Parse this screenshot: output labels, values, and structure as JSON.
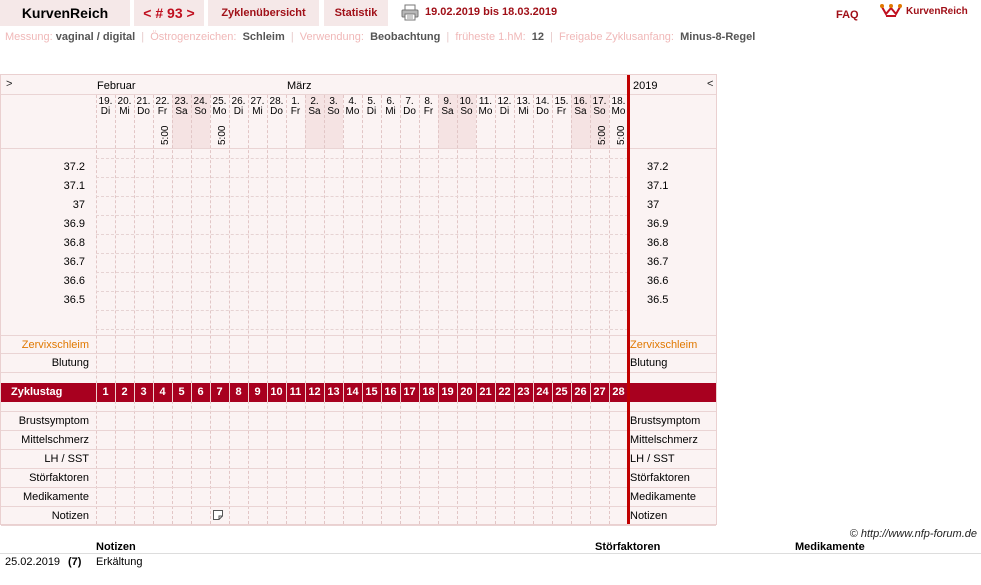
{
  "header": {
    "brand": "KurvenReich",
    "cycle_nav": "< # 93 >",
    "tab_overview": "Zyklenübersicht",
    "tab_statistics": "Statistik",
    "date_range": "19.02.2019 bis 18.03.2019",
    "faq": "FAQ",
    "logo_text": "KurvenReich",
    "accent_color": "#a01018"
  },
  "settings": {
    "measurement_label": "Messung:",
    "measurement_value": "vaginal / digital",
    "estrogen_label": "Östrogenzeichen:",
    "estrogen_value": "Schleim",
    "usage_label": "Verwendung:",
    "usage_value": "Beobachtung",
    "earliest_label": "früheste 1.hM:",
    "earliest_value": "12",
    "release_label": "Freigabe Zyklusanfang:",
    "release_value": "Minus-8-Regel"
  },
  "grid": {
    "nav_left": ">",
    "nav_right": "<",
    "month_feb": "Februar",
    "month_mar": "März",
    "year": "2019",
    "days": [
      {
        "d": "19.",
        "w": "Di",
        "weekend": false,
        "time": ""
      },
      {
        "d": "20.",
        "w": "Mi",
        "weekend": false,
        "time": ""
      },
      {
        "d": "21.",
        "w": "Do",
        "weekend": false,
        "time": ""
      },
      {
        "d": "22.",
        "w": "Fr",
        "weekend": false,
        "time": "5:00"
      },
      {
        "d": "23.",
        "w": "Sa",
        "weekend": true,
        "time": ""
      },
      {
        "d": "24.",
        "w": "So",
        "weekend": true,
        "time": ""
      },
      {
        "d": "25.",
        "w": "Mo",
        "weekend": false,
        "time": "5:00"
      },
      {
        "d": "26.",
        "w": "Di",
        "weekend": false,
        "time": ""
      },
      {
        "d": "27.",
        "w": "Mi",
        "weekend": false,
        "time": ""
      },
      {
        "d": "28.",
        "w": "Do",
        "weekend": false,
        "time": ""
      },
      {
        "d": "1.",
        "w": "Fr",
        "weekend": false,
        "time": ""
      },
      {
        "d": "2.",
        "w": "Sa",
        "weekend": true,
        "time": ""
      },
      {
        "d": "3.",
        "w": "So",
        "weekend": true,
        "time": ""
      },
      {
        "d": "4.",
        "w": "Mo",
        "weekend": false,
        "time": ""
      },
      {
        "d": "5.",
        "w": "Di",
        "weekend": false,
        "time": ""
      },
      {
        "d": "6.",
        "w": "Mi",
        "weekend": false,
        "time": ""
      },
      {
        "d": "7.",
        "w": "Do",
        "weekend": false,
        "time": ""
      },
      {
        "d": "8.",
        "w": "Fr",
        "weekend": false,
        "time": ""
      },
      {
        "d": "9.",
        "w": "Sa",
        "weekend": true,
        "time": ""
      },
      {
        "d": "10.",
        "w": "So",
        "weekend": true,
        "time": ""
      },
      {
        "d": "11.",
        "w": "Mo",
        "weekend": false,
        "time": ""
      },
      {
        "d": "12.",
        "w": "Di",
        "weekend": false,
        "time": ""
      },
      {
        "d": "13.",
        "w": "Mi",
        "weekend": false,
        "time": ""
      },
      {
        "d": "14.",
        "w": "Do",
        "weekend": false,
        "time": ""
      },
      {
        "d": "15.",
        "w": "Fr",
        "weekend": false,
        "time": ""
      },
      {
        "d": "16.",
        "w": "Sa",
        "weekend": true,
        "time": ""
      },
      {
        "d": "17.",
        "w": "So",
        "weekend": true,
        "time": "5:00"
      },
      {
        "d": "18.",
        "w": "Mo",
        "weekend": false,
        "time": "5:00"
      }
    ],
    "temperatures": [
      "37.2",
      "37.1",
      "37",
      "36.9",
      "36.8",
      "36.7",
      "36.6",
      "36.5"
    ],
    "row_zervix": "Zervixschleim",
    "row_blutung": "Blutung",
    "zyklustag_label": "Zyklustag",
    "cycle_days": [
      1,
      2,
      3,
      4,
      5,
      6,
      7,
      8,
      9,
      10,
      11,
      12,
      13,
      14,
      15,
      16,
      17,
      18,
      19,
      20,
      21,
      22,
      23,
      24,
      25,
      26,
      27,
      28
    ],
    "rows_bottom": [
      "Brustsymptom",
      "Mittelschmerz",
      "LH / SST",
      "Störfaktoren",
      "Medikamente",
      "Notizen"
    ],
    "note_day_index": 6,
    "zervix_color": "#e07800",
    "zyklus_color": "#a8001f"
  },
  "footer": {
    "copyright": "© http://www.nfp-forum.de",
    "col_notes": "Notizen",
    "col_stoer": "Störfaktoren",
    "col_medi": "Medikamente",
    "entry_date": "25.02.2019",
    "entry_day": "(7)",
    "entry_note": "Erkältung"
  }
}
